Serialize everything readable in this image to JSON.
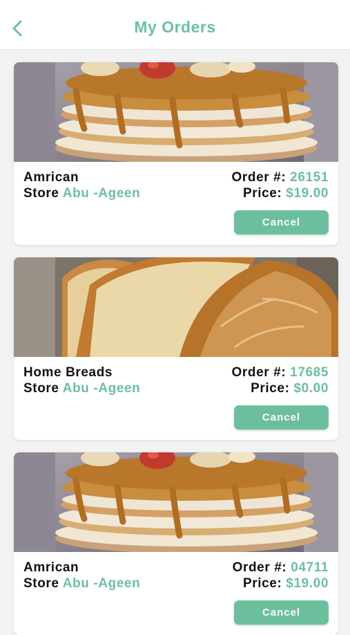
{
  "header": {
    "title": "My Orders",
    "back_icon": "chevron-left-icon"
  },
  "colors": {
    "accent": "#6dbf9f",
    "button": "#6cbf9c",
    "text": "#111111"
  },
  "labels": {
    "store_prefix": "Store",
    "order_prefix": "Order #:",
    "price_prefix": "Price:",
    "cancel": "Cancel"
  },
  "orders": [
    {
      "name": "Amrican",
      "store": "Abu -Ageen",
      "order_number": "26151",
      "price": "$19.00",
      "image": "pancakes-image"
    },
    {
      "name": "Home Breads",
      "store": "Abu -Ageen",
      "order_number": "17685",
      "price": "$0.00",
      "image": "bread-image"
    },
    {
      "name": "Amrican",
      "store": "Abu -Ageen",
      "order_number": "04711",
      "price": "$19.00",
      "image": "pancakes-image"
    }
  ]
}
